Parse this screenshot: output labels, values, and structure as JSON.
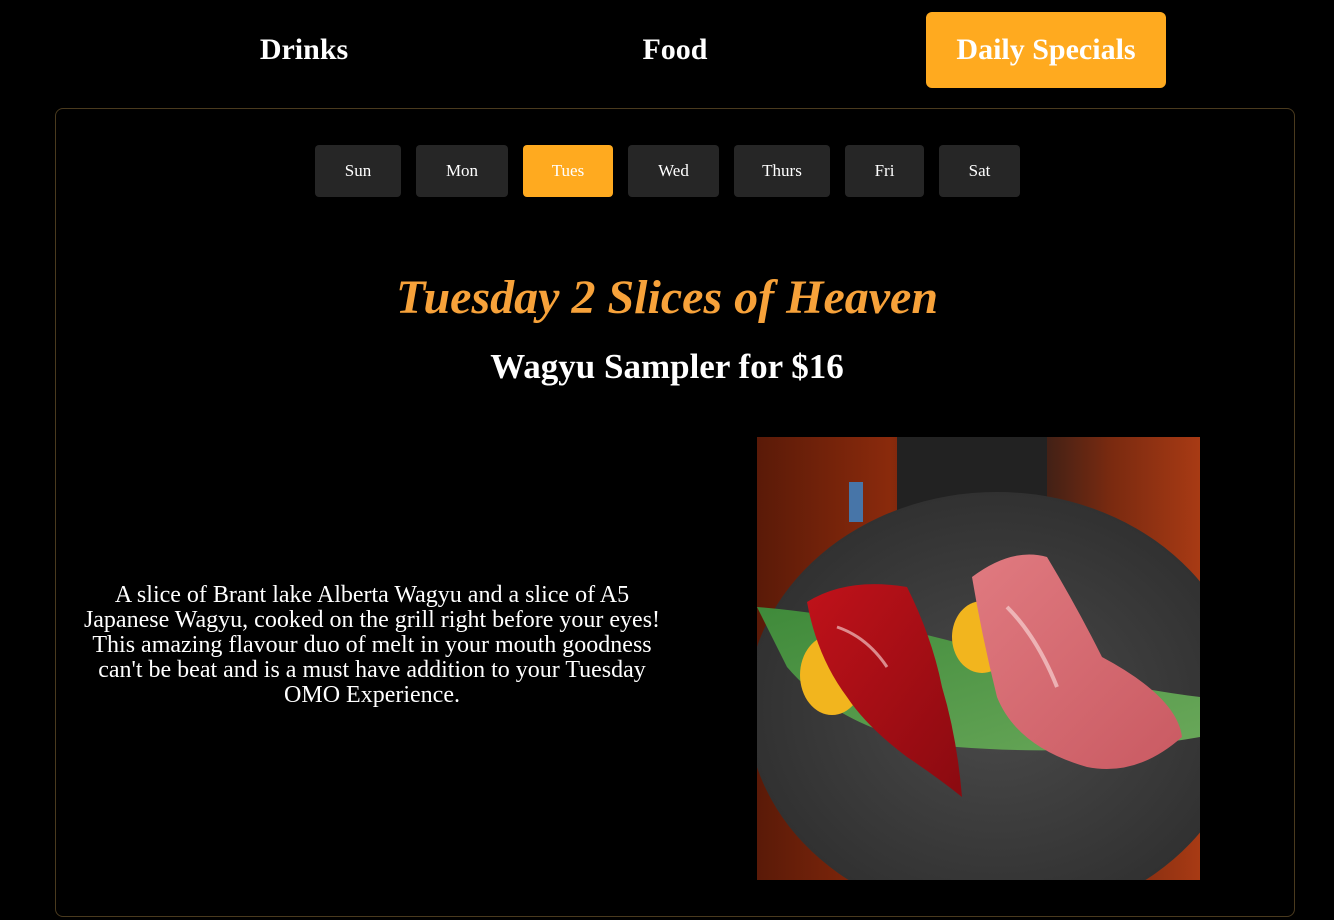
{
  "nav": {
    "tabs": [
      {
        "label": "Drinks",
        "active": false
      },
      {
        "label": "Food",
        "active": false
      },
      {
        "label": "Daily Specials",
        "active": true
      }
    ]
  },
  "days": {
    "items": [
      {
        "label": "Sun",
        "active": false
      },
      {
        "label": "Mon",
        "active": false
      },
      {
        "label": "Tues",
        "active": true
      },
      {
        "label": "Wed",
        "active": false
      },
      {
        "label": "Thurs",
        "active": false
      },
      {
        "label": "Fri",
        "active": false
      },
      {
        "label": "Sat",
        "active": false
      }
    ]
  },
  "special": {
    "title": "Tuesday 2 Slices of Heaven",
    "subtitle": "Wagyu Sampler for $16",
    "description": "A slice of Brant lake Alberta Wagyu and a slice of A5 Japanese Wagyu, cooked on the grill right before your eyes! This amazing flavour duo of melt in your mouth goodness can't be beat and is a must have addition to your Tuesday OMO Experience."
  },
  "colors": {
    "accent": "#ffaa1f",
    "title": "#f7a23a",
    "day_button_bg": "#262626",
    "panel_border": "#4a3a1e",
    "background": "#000000"
  }
}
